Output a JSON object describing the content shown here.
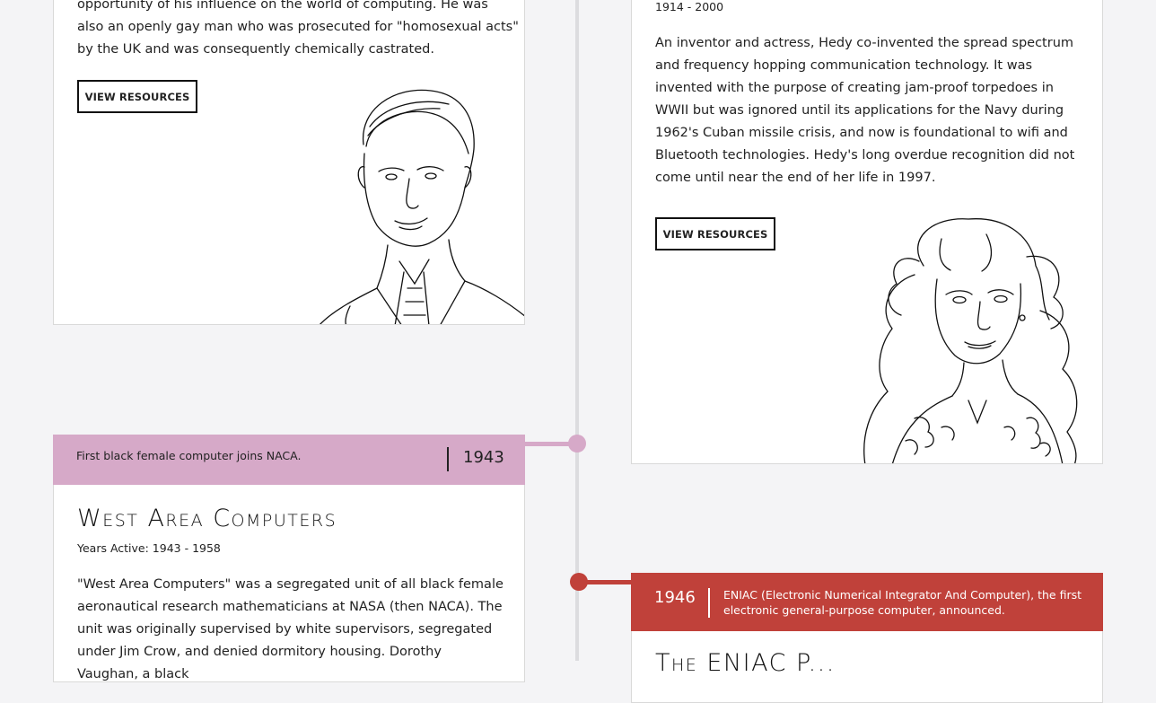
{
  "turing_card": {
    "clipped_line": "opportunity of his influence on the world of computing. He was",
    "text_line2": "also an openly gay man who was prosecuted for \"homosexual acts\"",
    "text_line3": "by the UK and was consequently chemically castrated.",
    "button_label": "VIEW RESOURCES"
  },
  "hedy_card": {
    "years": "1914 - 2000",
    "description": "An inventor and actress, Hedy co-invented the spread spectrum and frequency hopping communication technology. It was invented with the purpose of creating jam-proof torpedoes in WWII but was ignored until its applications for the Navy during 1962's Cuban missile crisis, and now is foundational to wifi and Bluetooth technologies. Hedy's long overdue recognition did not come until near the end of her life in 1997.",
    "button_label": "VIEW RESOURCES"
  },
  "event_1943": {
    "year": "1943",
    "summary": "First black female computer joins NACA.",
    "color": "#d6a9c8"
  },
  "west_area_card": {
    "title": "West Area Computers",
    "years": "Years Active: 1943 - 1958",
    "description": "\"West Area Computers\" was a segregated unit of all black female aeronautical research mathematicians at NASA (then NACA). The unit was originally supervised by white supervisors, segregated under Jim Crow, and denied dormitory housing. Dorothy Vaughan, a black"
  },
  "event_1946": {
    "year": "1946",
    "summary": "ENIAC (Electronic Numerical Integrator And Computer), the first electronic general-purpose computer, announced.",
    "color": "#c0413a"
  },
  "eniac_card": {
    "title_partial": "The ENIAC P..."
  }
}
